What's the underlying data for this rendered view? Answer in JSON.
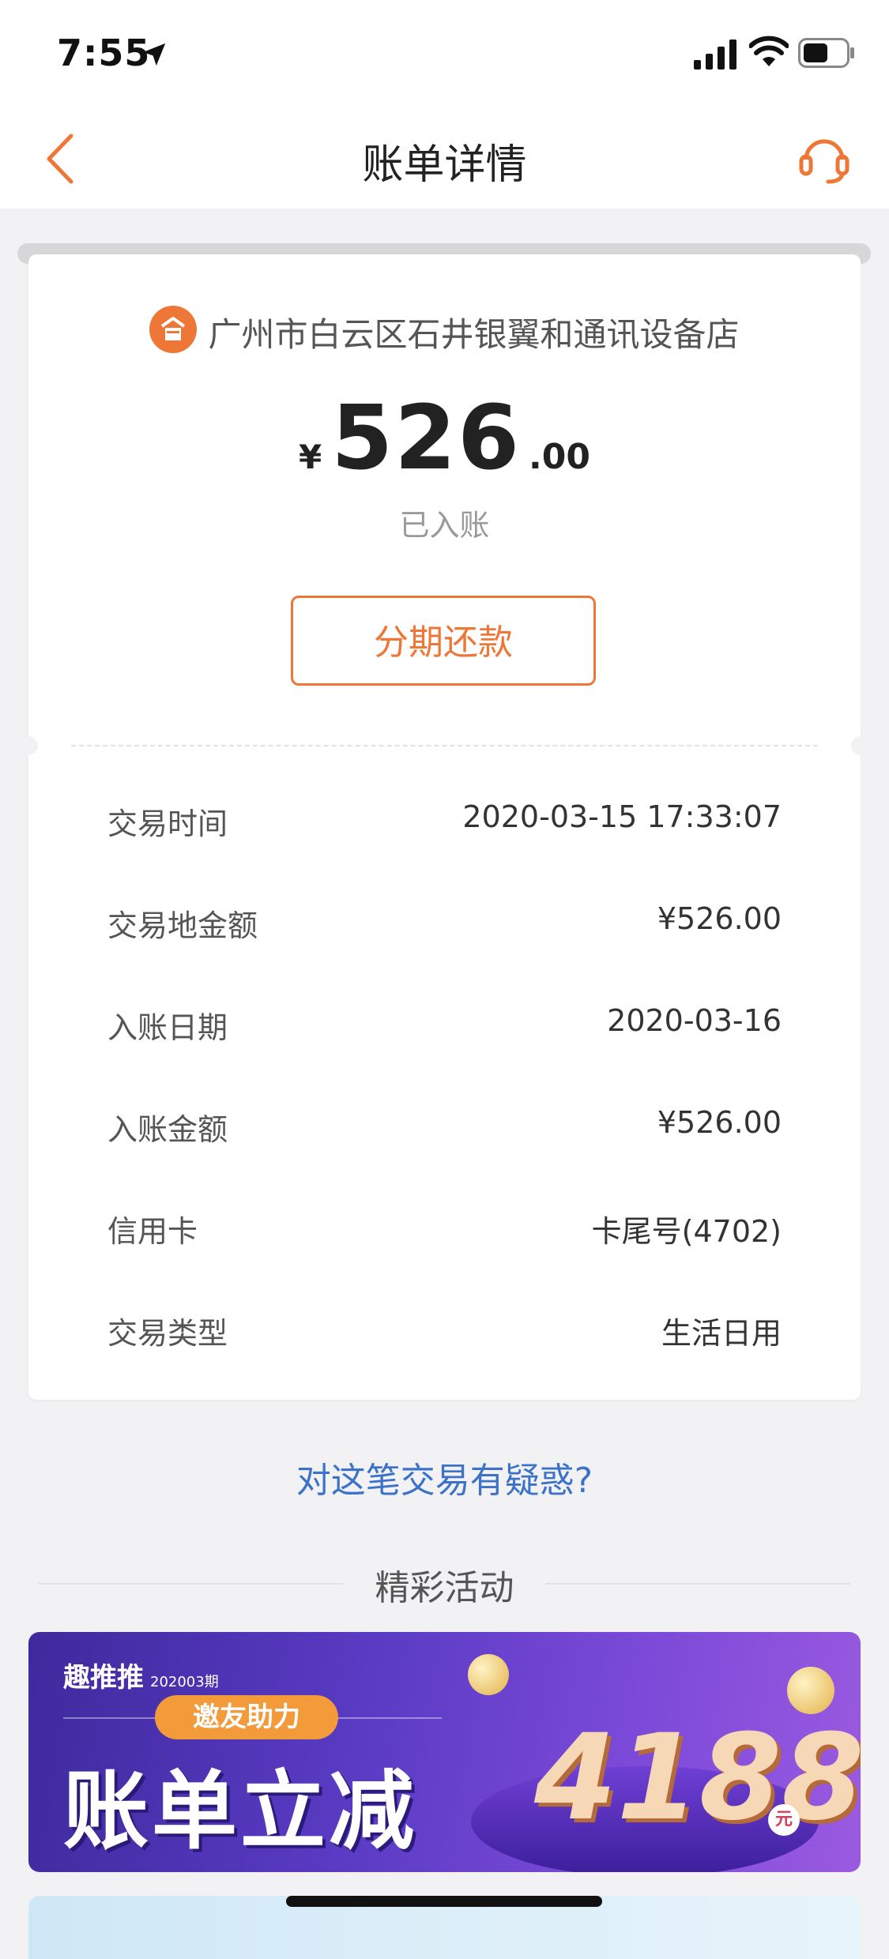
{
  "status_bar": {
    "time": "7:55"
  },
  "nav": {
    "title": "账单详情"
  },
  "card": {
    "merchant": "广州市白云区石井银翼和通讯设备店",
    "amount": {
      "currency": "¥",
      "integer": "526",
      "decimal": ".00"
    },
    "status": "已入账",
    "installment_label": "分期还款",
    "rows": [
      {
        "key": "交易时间",
        "value": "2020-03-15 17:33:07"
      },
      {
        "key": "交易地金额",
        "value": "¥526.00"
      },
      {
        "key": "入账日期",
        "value": "2020-03-16"
      },
      {
        "key": "入账金额",
        "value": "¥526.00"
      },
      {
        "key": "信用卡",
        "value": "卡尾号(4702)"
      },
      {
        "key": "交易类型",
        "value": "生活日用"
      }
    ]
  },
  "doubt_link": "对这笔交易有疑惑?",
  "section_title": "精彩活动",
  "banner": {
    "logo": "趣推推",
    "issue": "202003期",
    "pill": "邀友助力",
    "headline": "账单立减",
    "number": "4188",
    "unit": "元"
  },
  "colors": {
    "accent": "#ee7737",
    "link": "#3c73c9",
    "background": "#f2f2f4"
  },
  "icons": [
    "location-arrow-icon",
    "signal-icon",
    "wifi-icon",
    "battery-icon",
    "back-chevron-icon",
    "customer-service-icon",
    "merchant-store-icon"
  ]
}
